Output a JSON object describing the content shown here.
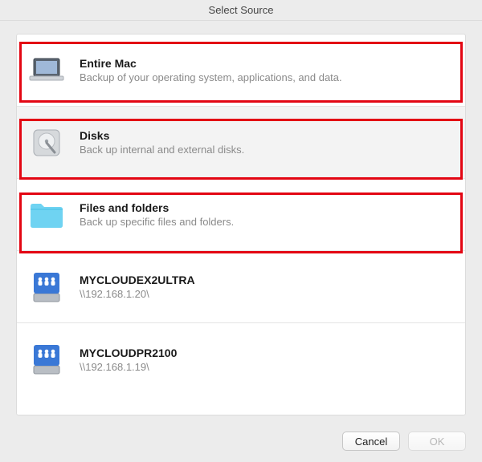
{
  "window": {
    "title": "Select Source"
  },
  "options": [
    {
      "title": "Entire Mac",
      "subtitle": "Backup of your operating system, applications, and data.",
      "highlighted": true,
      "selected": false,
      "icon": "laptop"
    },
    {
      "title": "Disks",
      "subtitle": "Back up internal and external disks.",
      "highlighted": true,
      "selected": true,
      "icon": "hdd"
    },
    {
      "title": "Files and folders",
      "subtitle": "Back up specific files and folders.",
      "highlighted": true,
      "selected": false,
      "icon": "folder"
    },
    {
      "title": "MYCLOUDEX2ULTRA",
      "subtitle": "\\\\192.168.1.20\\",
      "highlighted": false,
      "selected": false,
      "icon": "nas"
    },
    {
      "title": "MYCLOUDPR2100",
      "subtitle": "\\\\192.168.1.19\\",
      "highlighted": false,
      "selected": false,
      "icon": "nas"
    }
  ],
  "buttons": {
    "cancel": "Cancel",
    "ok": "OK"
  }
}
